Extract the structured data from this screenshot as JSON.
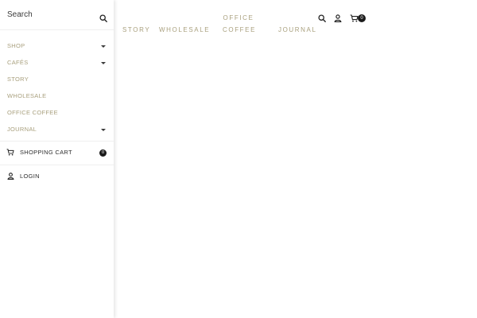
{
  "header": {
    "nav": {
      "story": "STORY",
      "wholesale": "WHOLESALE",
      "office_coffee": "OFFICE COFFEE",
      "journal": "JOURNAL"
    },
    "icons": {
      "search": "search-icon",
      "account": "account-icon",
      "cart": "cart-icon"
    },
    "cart_count": "0"
  },
  "drawer": {
    "search": {
      "placeholder": "Search",
      "icon": "search-icon"
    },
    "menu": [
      {
        "label": "SHOP",
        "has_submenu": true
      },
      {
        "label": "CAFÉS",
        "has_submenu": true
      },
      {
        "label": "STORY",
        "has_submenu": false
      },
      {
        "label": "WHOLESALE",
        "has_submenu": false
      },
      {
        "label": "OFFICE COFFEE",
        "has_submenu": false
      },
      {
        "label": "JOURNAL",
        "has_submenu": true
      }
    ],
    "shopping_cart": {
      "label": "SHOPPING CART",
      "count": "0",
      "icon": "cart-icon"
    },
    "login": {
      "label": "LOGIN",
      "icon": "account-icon"
    }
  },
  "colors": {
    "nav_text": "#a9a07e",
    "dark_text": "#2f2f2f",
    "badge": "#1b1b1b",
    "divider": "#efefef"
  }
}
